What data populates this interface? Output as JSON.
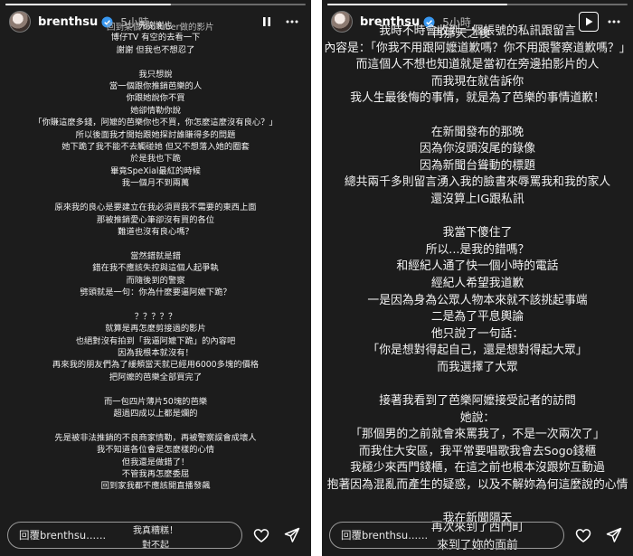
{
  "left_story": {
    "username": "brenthsu",
    "time_ago": "5小時",
    "progress": 0.55,
    "top_overlay": "回到某個YouTuber做的影片",
    "lines": [
      "先謝謝也",
      "博仔TV 有空的去看一下",
      "謝謝 但我也不想忍了",
      "",
      "我只想說",
      "當一個跟你推銷芭樂的人",
      "你跟她說你不買",
      "她卻情勒你說",
      "「你賺這麼多錢，阿嬤的芭樂你也不買，你怎麼這麼沒有良心？」",
      "所以後面我才開始跟她探討誰賺得多的問題",
      "她下跪了我不能不去觸碰她 但又不想落入她的圈套",
      "於是我也下跪",
      "畢竟SpeXial最紅的時候",
      "我一個月不到兩萬",
      "",
      "原來我的良心是要建立在我必須買我不需要的東西上面",
      "那被推銷愛心筆卻沒有買的各位",
      "難道也沒有良心嗎？",
      "",
      "當然錯就是錯",
      "錯在我不應該失控與這個人起爭執",
      "而隨後到的警察",
      "劈頭就是一句：你為什麼要逼阿嬤下跪？",
      "",
      "？？？？？",
      "就算是再怎麼剪接過的影片",
      "也絕對沒有拍到「我逼阿嬤下跪」的內容吧",
      "因為我根本就沒有！",
      "再來我的朋友們為了緩頰當天就已經用6000多塊的價格",
      "把阿嬤的芭樂全部買完了",
      "",
      "而一包四片薄片50塊的芭樂",
      "超過四成以上都是爛的",
      "",
      "先是被非法推銷的不良商家情勒，再被警察誤會成壞人",
      "我不知道各位會是怎麼樣的心情",
      "但我還是做錯了！",
      "不管我再怎麼委屈",
      "回到家我都不應該開直播發飆"
    ],
    "reply_placeholder": "回覆brenthsu......",
    "bottom_caption_1": "我真糟糕！",
    "bottom_caption_2": "對不起"
  },
  "right_story": {
    "username": "brenthsu",
    "time_ago": "5小時",
    "progress": 0.6,
    "top_overlay": "再那天之後",
    "lines": [
      "我時不時會收到一個帳號的私訊跟留言",
      "內容是：「你我不用跟阿嬤道歉嗎？你不用跟警察道歉嗎？」",
      "而這個人不想也知道就是當初在旁邊拍影片的人",
      "而我現在就告訴你",
      "我人生最後悔的事情，就是為了芭樂的事情道歉！",
      "",
      "在新聞發布的那晚",
      "因為你沒頭沒尾的錄像",
      "因為新聞台聳動的標題",
      "總共兩千多則留言湧入我的臉書來辱罵我和我的家人",
      "還沒算上IG跟私訊",
      "",
      "我當下傻住了",
      "所以...是我的錯嗎？",
      "和經紀人通了快一個小時的電話",
      "經紀人希望我道歉",
      "一是因為身為公眾人物本來就不該挑起事端",
      "二是為了平息輿論",
      "他只說了一句話：",
      "「你是想對得起自己，還是想對得起大眾」",
      "而我選擇了大眾",
      "",
      "接著我看到了芭樂阿嬤接受記者的訪問",
      "她說：",
      "「那個男的之前就會來罵我了，不是一次兩次了」",
      "而我住大安區，我平常要唱歌我會去Sogo錢櫃",
      "我極少來西門錢櫃，在這之前也根本沒跟妳互動過",
      "抱著因為混亂而產生的疑惑，以及不解妳為何這麼說的心情",
      "",
      "我在新聞隔天"
    ],
    "reply_placeholder": "回覆brenthsu......",
    "bottom_caption_1": "再次來到了西門町",
    "bottom_caption_2": "來到了妳的面前"
  },
  "icons": {
    "pause": "pause-icon",
    "play": "play-icon",
    "more": "more-icon",
    "heart": "heart-icon",
    "send": "send-icon",
    "verified": "verified-badge-icon"
  },
  "colors": {
    "story_bg": "#1c1c1c",
    "verified": "#3897f0",
    "text": "#f2f2f2"
  }
}
